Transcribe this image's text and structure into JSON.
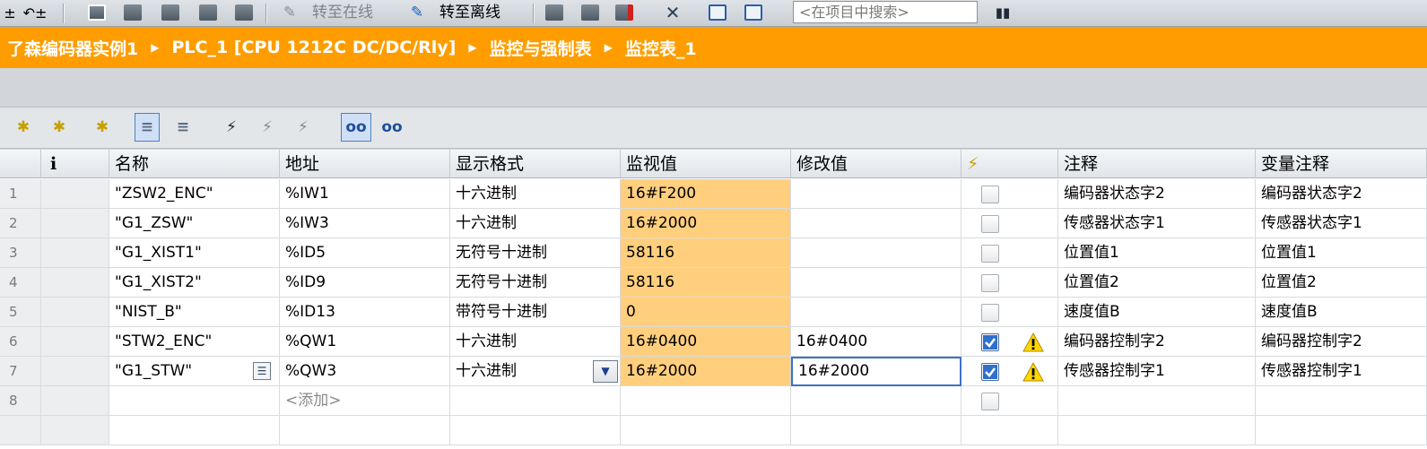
{
  "toolbar": {
    "go_online": "转至在线",
    "go_offline": "转至离线",
    "search_placeholder": "<在项目中搜索>"
  },
  "breadcrumb": [
    "了森编码器实例1",
    "PLC_1 [CPU 1212C DC/DC/Rly]",
    "监控与强制表",
    "监控表_1"
  ],
  "columns": {
    "info": "i",
    "name": "名称",
    "address": "地址",
    "format": "显示格式",
    "monitor": "监视值",
    "modify": "修改值",
    "comment": "注释",
    "var_comment": "变量注释"
  },
  "rows": [
    {
      "num": "1",
      "name": "\"ZSW2_ENC\"",
      "address": "%IW1",
      "format": "十六进制",
      "monitor": "16#F200",
      "modify": "",
      "checked": false,
      "warn": false,
      "comment": "编码器状态字2",
      "var_comment": "编码器状态字2"
    },
    {
      "num": "2",
      "name": "\"G1_ZSW\"",
      "address": "%IW3",
      "format": "十六进制",
      "monitor": "16#2000",
      "modify": "",
      "checked": false,
      "warn": false,
      "comment": "传感器状态字1",
      "var_comment": "传感器状态字1"
    },
    {
      "num": "3",
      "name": "\"G1_XIST1\"",
      "address": "%ID5",
      "format": "无符号十进制",
      "monitor": "58116",
      "modify": "",
      "checked": false,
      "warn": false,
      "comment": "位置值1",
      "var_comment": "位置值1"
    },
    {
      "num": "4",
      "name": "\"G1_XIST2\"",
      "address": "%ID9",
      "format": "无符号十进制",
      "monitor": "58116",
      "modify": "",
      "checked": false,
      "warn": false,
      "comment": "位置值2",
      "var_comment": "位置值2"
    },
    {
      "num": "5",
      "name": "\"NIST_B\"",
      "address": "%ID13",
      "format": "带符号十进制",
      "monitor": "0",
      "modify": "",
      "checked": false,
      "warn": false,
      "comment": "速度值B",
      "var_comment": "速度值B"
    },
    {
      "num": "6",
      "name": "\"STW2_ENC\"",
      "address": "%QW1",
      "format": "十六进制",
      "monitor": "16#0400",
      "modify": "16#0400",
      "checked": true,
      "warn": true,
      "comment": "编码器控制字2",
      "var_comment": "编码器控制字2"
    },
    {
      "num": "7",
      "name": "\"G1_STW\"",
      "address": "%QW3",
      "format": "十六进制",
      "monitor": "16#2000",
      "modify": "16#2000",
      "checked": true,
      "warn": true,
      "comment": "传感器控制字1",
      "var_comment": "传感器控制字1"
    }
  ],
  "add_row": {
    "num": "8",
    "label": "<添加>"
  },
  "colors": {
    "accent": "#ff9d00",
    "monitor_cell": "#ffcf7d"
  }
}
